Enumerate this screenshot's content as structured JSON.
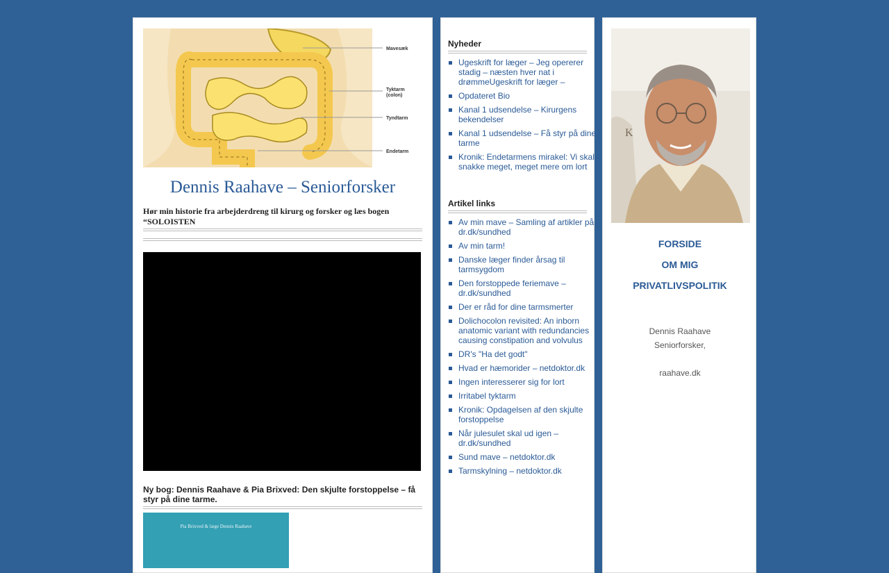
{
  "main": {
    "header_image": {
      "icon": "intestine-anatomy-illustration",
      "labels": [
        "Mavesæk",
        "Tyktarm",
        "(colon)",
        "Tyndtarm",
        "Endetarm"
      ]
    },
    "site_title": "Dennis Raahave – Seniorforsker",
    "tagline": "Hør min historie fra arbejderdreng til kirurg og forsker og læs bogen “SOLOISTEN",
    "book_title": "Ny bog: Dennis Raahave & Pia Brixved: Den skjulte forstoppelse – få styr på dine tarme.",
    "book_cover_text": "Pia Brixved & læge Dennis Raahave"
  },
  "sidebar": {
    "news_title": "Nyheder",
    "news": [
      "Ugeskrift for læger – Jeg opererer stadig – næsten hver nat i drømmeUgeskrift for læger –",
      "Opdateret Bio",
      "Kanal 1 udsendelse – Kirurgens bekendelser",
      "Kanal 1 udsendelse – Få styr på dine tarme",
      "Kronik: Endetarmens mirakel: Vi skal snakke meget, meget mere om lort"
    ],
    "links_title": "Artikel links",
    "links": [
      "Av min mave – Samling af artikler på dr.dk/sundhed",
      "Av min tarm!",
      "Danske læger finder årsag til tarmsygdom",
      "Den forstoppede feriemave – dr.dk/sundhed",
      "Der er råd for dine tarmsmerter",
      "Dolichocolon revisited: An inborn anatomic variant with redundancies causing constipation and volvulus",
      "DR's \"Ha det godt\"",
      "Hvad er hæmorider – netdoktor.dk",
      "Ingen interesserer sig for lort",
      "Irritabel tyktarm",
      "Kronik: Opdagelsen af den skjulte forstoppelse",
      "Når julesulet skal ud igen – dr.dk/sundhed",
      "Sund mave – netdoktor.dk",
      "Tarmskylning – netdoktor.dk"
    ]
  },
  "right": {
    "nav": [
      "FORSIDE",
      "OM MIG",
      "PRIVATLIVSPOLITIK"
    ],
    "name": "Dennis Raahave",
    "role": "Seniorforsker,",
    "site": "raahave.dk"
  },
  "colors": {
    "background": "#2f6196",
    "link": "#2a5a96",
    "book_cover": "#33a0b4",
    "video": "#000000"
  }
}
